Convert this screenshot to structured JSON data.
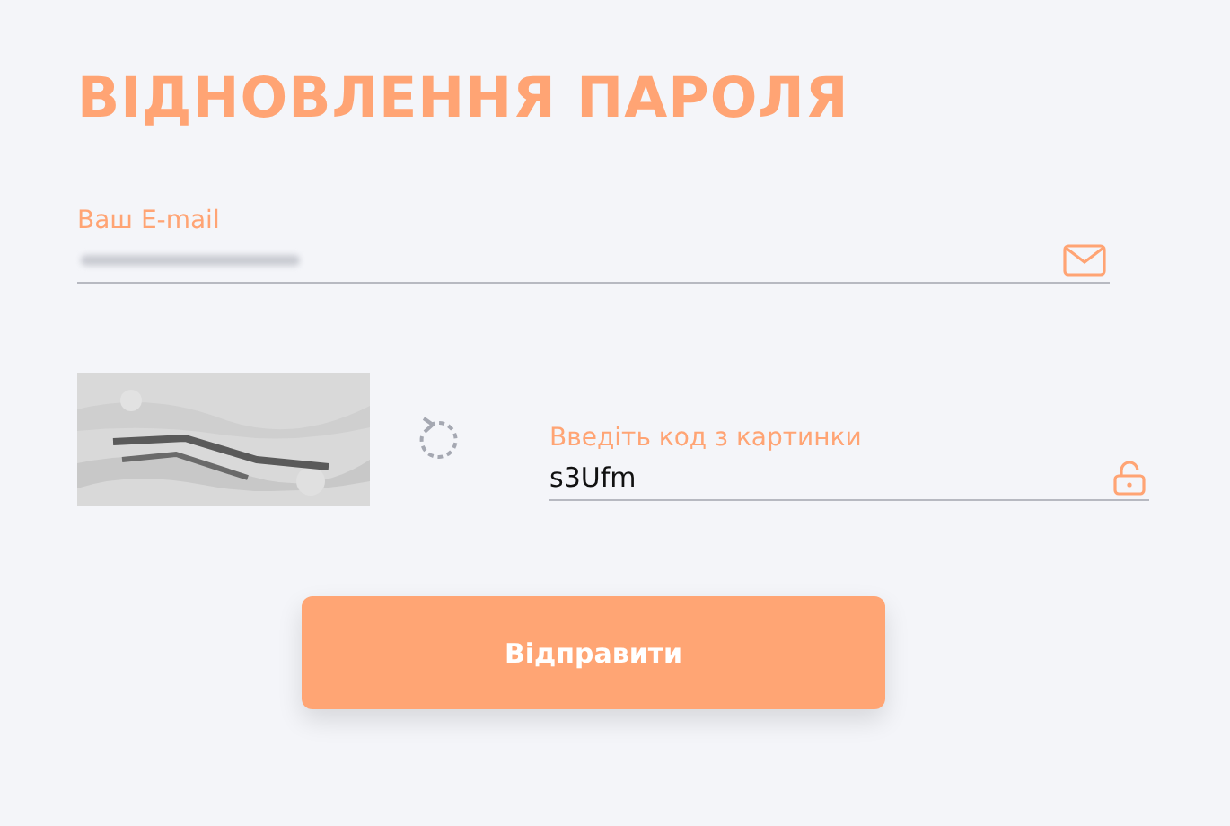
{
  "title": "ВІДНОВЛЕННЯ ПАРОЛЯ",
  "email": {
    "label": "Ваш E-mail",
    "blurred": true
  },
  "captcha": {
    "kind": "picture",
    "label": "Введіть код з картинки",
    "value": "s3Ufm"
  },
  "submit": {
    "label": "Відправити"
  }
}
